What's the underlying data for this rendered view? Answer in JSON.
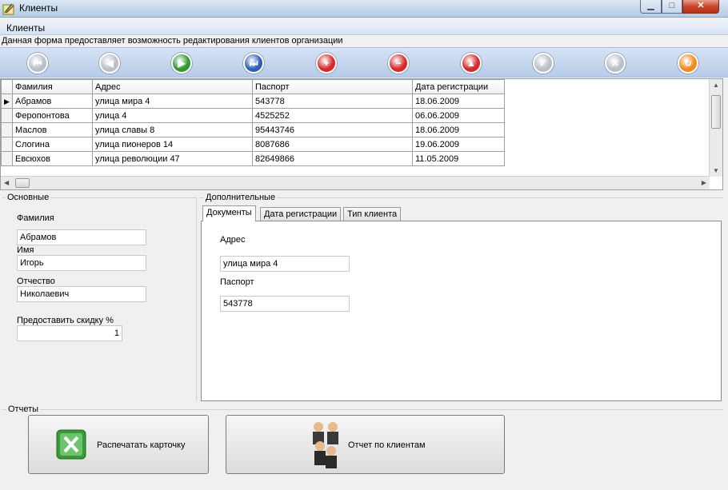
{
  "window": {
    "title": "Клиенты"
  },
  "menu": {
    "label": "Клиенты"
  },
  "description": "Данная форма предоставляет  возможность редактирования клиентов организации",
  "navigator": [
    {
      "icon": "first-record-icon",
      "glyph": "⏮",
      "color": "#b8bfc8"
    },
    {
      "icon": "prev-record-icon",
      "glyph": "◀",
      "color": "#b8bfc8"
    },
    {
      "icon": "next-record-icon",
      "glyph": "▶",
      "color": "#2e9a2e"
    },
    {
      "icon": "last-record-icon",
      "glyph": "⏭",
      "color": "#2b5fb8"
    },
    {
      "icon": "add-record-icon",
      "glyph": "+",
      "color": "#d42a2a"
    },
    {
      "icon": "delete-record-icon",
      "glyph": "−",
      "color": "#d42a2a"
    },
    {
      "icon": "edit-record-icon",
      "glyph": "▲",
      "color": "#d42a2a"
    },
    {
      "icon": "post-record-icon",
      "glyph": "✓",
      "color": "#b8bfc8"
    },
    {
      "icon": "cancel-record-icon",
      "glyph": "✕",
      "color": "#b8bfc8"
    },
    {
      "icon": "refresh-record-icon",
      "glyph": "↻",
      "color": "#f08a1a"
    }
  ],
  "grid": {
    "columns": [
      "Фамилия",
      "Адрес",
      "Паспорт",
      "Дата регистрации"
    ],
    "rows": [
      [
        "Абрамов",
        "улица мира 4",
        "543778",
        "18.06.2009"
      ],
      [
        "Феропонтова",
        "улица 4",
        "4525252",
        "06.06.2009"
      ],
      [
        "Маслов",
        "улица славы 8",
        "95443746",
        "18.06.2009"
      ],
      [
        "Слогина",
        "улица пионеров 14",
        "8087686",
        "19.06.2009"
      ],
      [
        "Евсюхов",
        "улица революции 47",
        "82649866",
        "11.05.2009"
      ]
    ],
    "current_row_marker": "▶"
  },
  "main_group": {
    "title": "Основные",
    "surname_label": "Фамилия",
    "surname_value": "Абрамов",
    "name_label": "Имя",
    "name_value": "Игорь",
    "patronymic_label": "Отчество",
    "patronymic_value": "Николаевич",
    "discount_label": "Предоставить скидку  %",
    "discount_value": "1"
  },
  "extra_group": {
    "title": "Дополнительные",
    "tabs": [
      "Документы",
      "Дата регистрации",
      "Тип клиента"
    ],
    "address_label": "Адрес",
    "address_value": "улица мира 4",
    "passport_label": "Паспорт",
    "passport_value": "543778"
  },
  "reports": {
    "title": "Отчеты",
    "print_card_label": "Распечатать карточку",
    "clients_report_label": "Отчет по клиентам"
  }
}
